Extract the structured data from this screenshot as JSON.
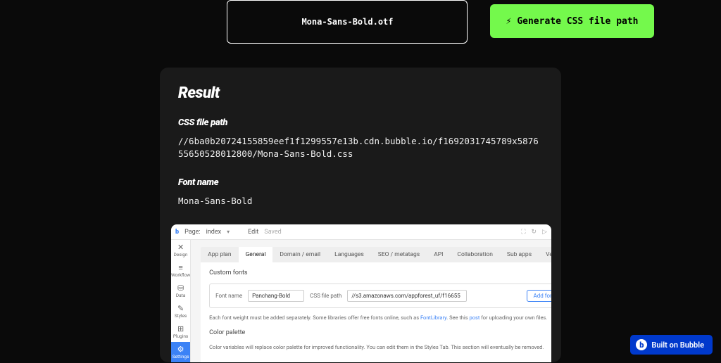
{
  "top": {
    "file_name": "Mona-Sans-Bold.otf",
    "generate_btn": "Generate CSS file path"
  },
  "result": {
    "title": "Result",
    "css_label": "CSS file path",
    "css_value": "//6ba0b20724155859eef1f1299557e13b.cdn.bubble.io/f1692031745789x587655650528012800/Mona-Sans-Bold.css",
    "font_label": "Font name",
    "font_value": "Mona-Sans-Bold"
  },
  "editor": {
    "top": {
      "page_label": "Page:",
      "page_name": "index",
      "edit": "Edit",
      "saved": "Saved"
    },
    "sidebar": [
      {
        "icon": "✕",
        "label": "Design"
      },
      {
        "icon": "≡",
        "label": "Workflow"
      },
      {
        "icon": "⛁",
        "label": "Data"
      },
      {
        "icon": "✎",
        "label": "Styles"
      },
      {
        "icon": "⊞",
        "label": "Plugins"
      },
      {
        "icon": "⚙",
        "label": "Settings"
      }
    ],
    "tabs": [
      "App plan",
      "General",
      "Domain / email",
      "Languages",
      "SEO / metatags",
      "API",
      "Collaboration",
      "Sub apps",
      "Versions"
    ],
    "active_tab": 1,
    "panel": {
      "custom_fonts": "Custom fonts",
      "font_name_lbl": "Font name",
      "font_name_val": "Panchang-Bold",
      "css_path_lbl": "CSS file path",
      "css_path_val": "//s3.amazonaws.com/appforest_uf/f16655",
      "add_font": "Add font",
      "help1_a": "Each font weight must be added separately. Some libraries offer free fonts online, such as ",
      "help1_link1": "FontLibrary",
      "help1_b": ". See this ",
      "help1_link2": "post",
      "help1_c": " for uploading your own files.",
      "color_palette": "Color palette",
      "help2": "Color variables will replace color palette for improved functionality. You can edit them in the Styles Tab. This section will eventually be removed."
    }
  },
  "badge": "Built on Bubble"
}
